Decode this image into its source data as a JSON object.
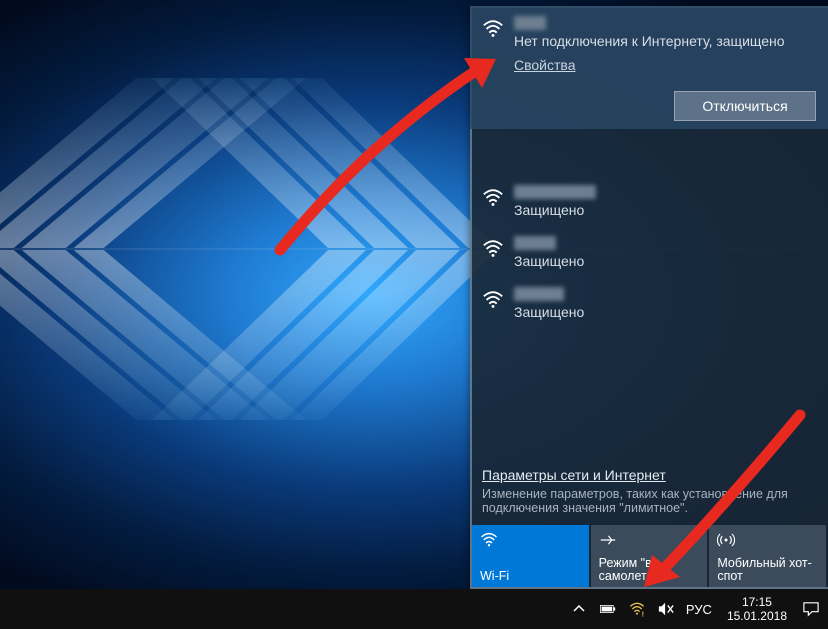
{
  "connected": {
    "status": "Нет подключения к Интернету, защищено",
    "properties": "Свойства",
    "disconnect": "Отключиться"
  },
  "others": [
    {
      "status": "Защищено"
    },
    {
      "status": "Защищено"
    },
    {
      "status": "Защищено"
    }
  ],
  "settings": {
    "header": "Параметры сети и Интернет",
    "sub": "Изменение параметров, таких как установление для подключения значения \"лимитное\"."
  },
  "tiles": {
    "wifi": "Wi-Fi",
    "airplane": "Режим \"в самолете\"",
    "hotspot": "Мобильный хот-спот"
  },
  "tray": {
    "lang": "РУС",
    "time": "17:15",
    "date": "15.01.2018"
  }
}
